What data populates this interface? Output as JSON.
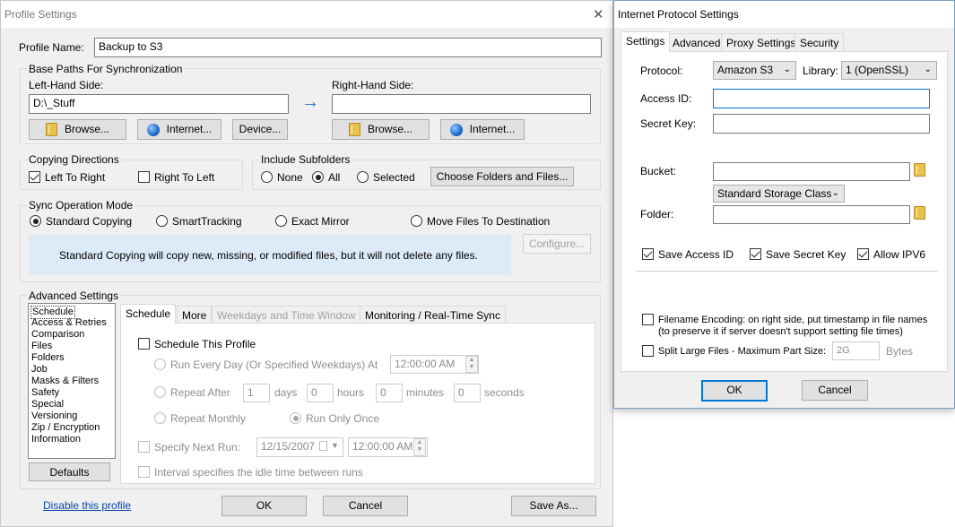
{
  "profile_window": {
    "title": "Profile Settings",
    "close_glyph": "✕",
    "profile_name_label": "Profile Name:",
    "profile_name_value": "Backup to S3",
    "base_paths": {
      "legend": "Base Paths For Synchronization",
      "left_label": "Left-Hand Side:",
      "left_value": "D:\\_Stuff",
      "right_label": "Right-Hand Side:",
      "right_value": "",
      "arrow_glyph": "→",
      "left_buttons": [
        "Browse...",
        "Internet...",
        "Device..."
      ],
      "right_buttons": [
        "Browse...",
        "Internet..."
      ]
    },
    "copying_directions": {
      "legend": "Copying Directions",
      "left_to_right": "Left To Right",
      "right_to_left": "Right To Left"
    },
    "include_subfolders": {
      "legend": "Include Subfolders",
      "none": "None",
      "all": "All",
      "selected": "Selected",
      "choose_button": "Choose Folders and Files..."
    },
    "sync_mode": {
      "legend": "Sync Operation Mode",
      "options": [
        "Standard Copying",
        "SmartTracking",
        "Exact Mirror",
        "Move Files To Destination"
      ],
      "selected": "Standard Copying",
      "info": "Standard Copying will copy new, missing, or modified files, but it will not delete any files.",
      "configure_button": "Configure..."
    },
    "advanced": {
      "legend": "Advanced Settings",
      "list": [
        "Schedule",
        "Access & Retries",
        "Comparison",
        "Files",
        "Folders",
        "Job",
        "Masks & Filters",
        "Safety",
        "Special",
        "Versioning",
        "Zip / Encryption",
        "Information"
      ],
      "selected_item": "Schedule",
      "defaults_button": "Defaults",
      "tabs": [
        "Schedule",
        "More",
        "Weekdays and Time Window",
        "Monitoring / Real-Time Sync"
      ],
      "active_tab": "Schedule",
      "schedule": {
        "schedule_this_profile": "Schedule This Profile",
        "run_every_day": "Run Every Day (Or Specified Weekdays) At",
        "run_every_day_time": "12:00:00 AM",
        "repeat_after": "Repeat After",
        "days_value": "1",
        "days_label": "days",
        "hours_value": "0",
        "hours_label": "hours",
        "minutes_value": "0",
        "minutes_label": "minutes",
        "seconds_value": "0",
        "seconds_label": "seconds",
        "repeat_monthly": "Repeat Monthly",
        "run_only_once": "Run Only Once",
        "specify_next_run": "Specify Next Run:",
        "next_run_date": "12/15/2007",
        "next_run_time": "12:00:00 AM",
        "interval_idle": "Interval specifies the idle time between runs"
      }
    },
    "footer": {
      "disable_link": "Disable this profile",
      "ok": "OK",
      "cancel": "Cancel",
      "save_as": "Save As..."
    }
  },
  "ip_window": {
    "title": "Internet Protocol Settings",
    "tabs": [
      "Settings",
      "Advanced",
      "Proxy Settings",
      "Security"
    ],
    "active_tab": "Settings",
    "protocol_label": "Protocol:",
    "protocol_value": "Amazon S3",
    "library_label": "Library:",
    "library_value": "1 (OpenSSL)",
    "access_id_label": "Access ID:",
    "access_id_value": "",
    "secret_key_label": "Secret Key:",
    "secret_key_value": "",
    "bucket_label": "Bucket:",
    "bucket_value": "",
    "storage_class": "Standard Storage Class",
    "folder_label": "Folder:",
    "folder_value": "",
    "save_access_id": "Save Access ID",
    "save_secret_key": "Save Secret Key",
    "allow_ipv6": "Allow IPV6",
    "filename_encoding_line1": "Filename Encoding: on right side, put timestamp in file names",
    "filename_encoding_line2": "(to preserve it if server doesn't support setting file times)",
    "split_large_files": "Split Large Files - Maximum Part Size:",
    "split_size": "2G",
    "split_unit": "Bytes",
    "ok": "OK",
    "cancel": "Cancel"
  },
  "colors": {
    "window_bg": "#f0f0f0",
    "info_box": "#ddeaf7",
    "focus_blue": "#0078d7",
    "arrow_blue": "#1f6fc5",
    "link_blue": "#0645ad"
  }
}
